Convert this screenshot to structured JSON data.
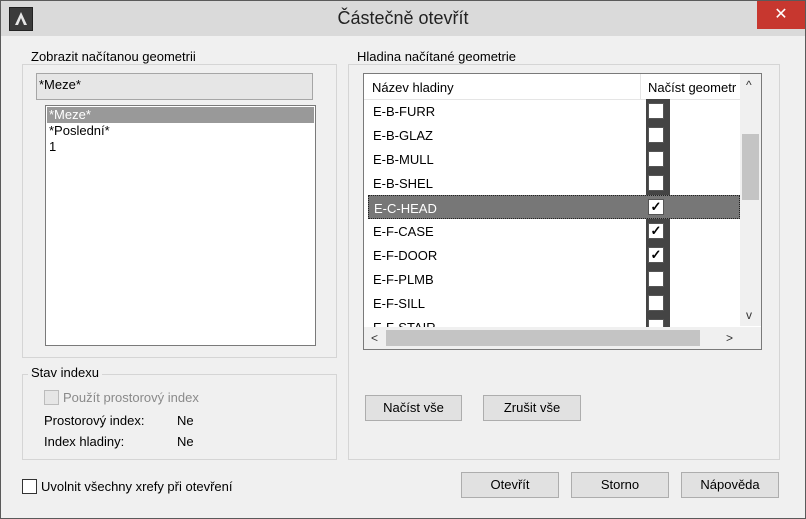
{
  "window": {
    "title": "Částečně otevřít",
    "close_glyph": "✕"
  },
  "left_group": {
    "label": "Zobrazit načítanou geometrii",
    "current_view": "*Meze*",
    "views": [
      "*Meze*",
      "*Poslední*",
      "1"
    ],
    "selected_index": 0
  },
  "index_group": {
    "label": "Stav indexu",
    "use_spatial_index": {
      "label": "Použít prostorový index",
      "checked": false,
      "disabled": true
    },
    "spatial_index": {
      "label": "Prostorový index:",
      "value": "Ne"
    },
    "layer_index": {
      "label": "Index hladiny:",
      "value": "Ne"
    }
  },
  "right_group": {
    "label": "Hladina načítané geometrie",
    "columns": [
      "Název hladiny",
      "Načíst geometr"
    ],
    "layers": [
      {
        "name": "E-B-FURR",
        "checked": false
      },
      {
        "name": "E-B-GLAZ",
        "checked": false
      },
      {
        "name": "E-B-MULL",
        "checked": false
      },
      {
        "name": "E-B-SHEL",
        "checked": false
      },
      {
        "name": "E-C-HEAD",
        "checked": true,
        "selected": true
      },
      {
        "name": "E-F-CASE",
        "checked": true
      },
      {
        "name": "E-F-DOOR",
        "checked": true
      },
      {
        "name": "E-F-PLMB",
        "checked": false
      },
      {
        "name": "E-F-SILL",
        "checked": false
      },
      {
        "name": "E-F-STAIR",
        "checked": false
      }
    ],
    "load_all": "Načíst vše",
    "clear_all": "Zrušit vše"
  },
  "footer": {
    "unload_xrefs": {
      "label": "Uvolnit všechny xrefy při otevření",
      "checked": false
    },
    "open": "Otevřít",
    "cancel": "Storno",
    "help": "Nápověda"
  },
  "glyphs": {
    "check": "✓",
    "arrow_up": "^",
    "arrow_down": "v",
    "arrow_left": "<",
    "arrow_right": ">"
  }
}
